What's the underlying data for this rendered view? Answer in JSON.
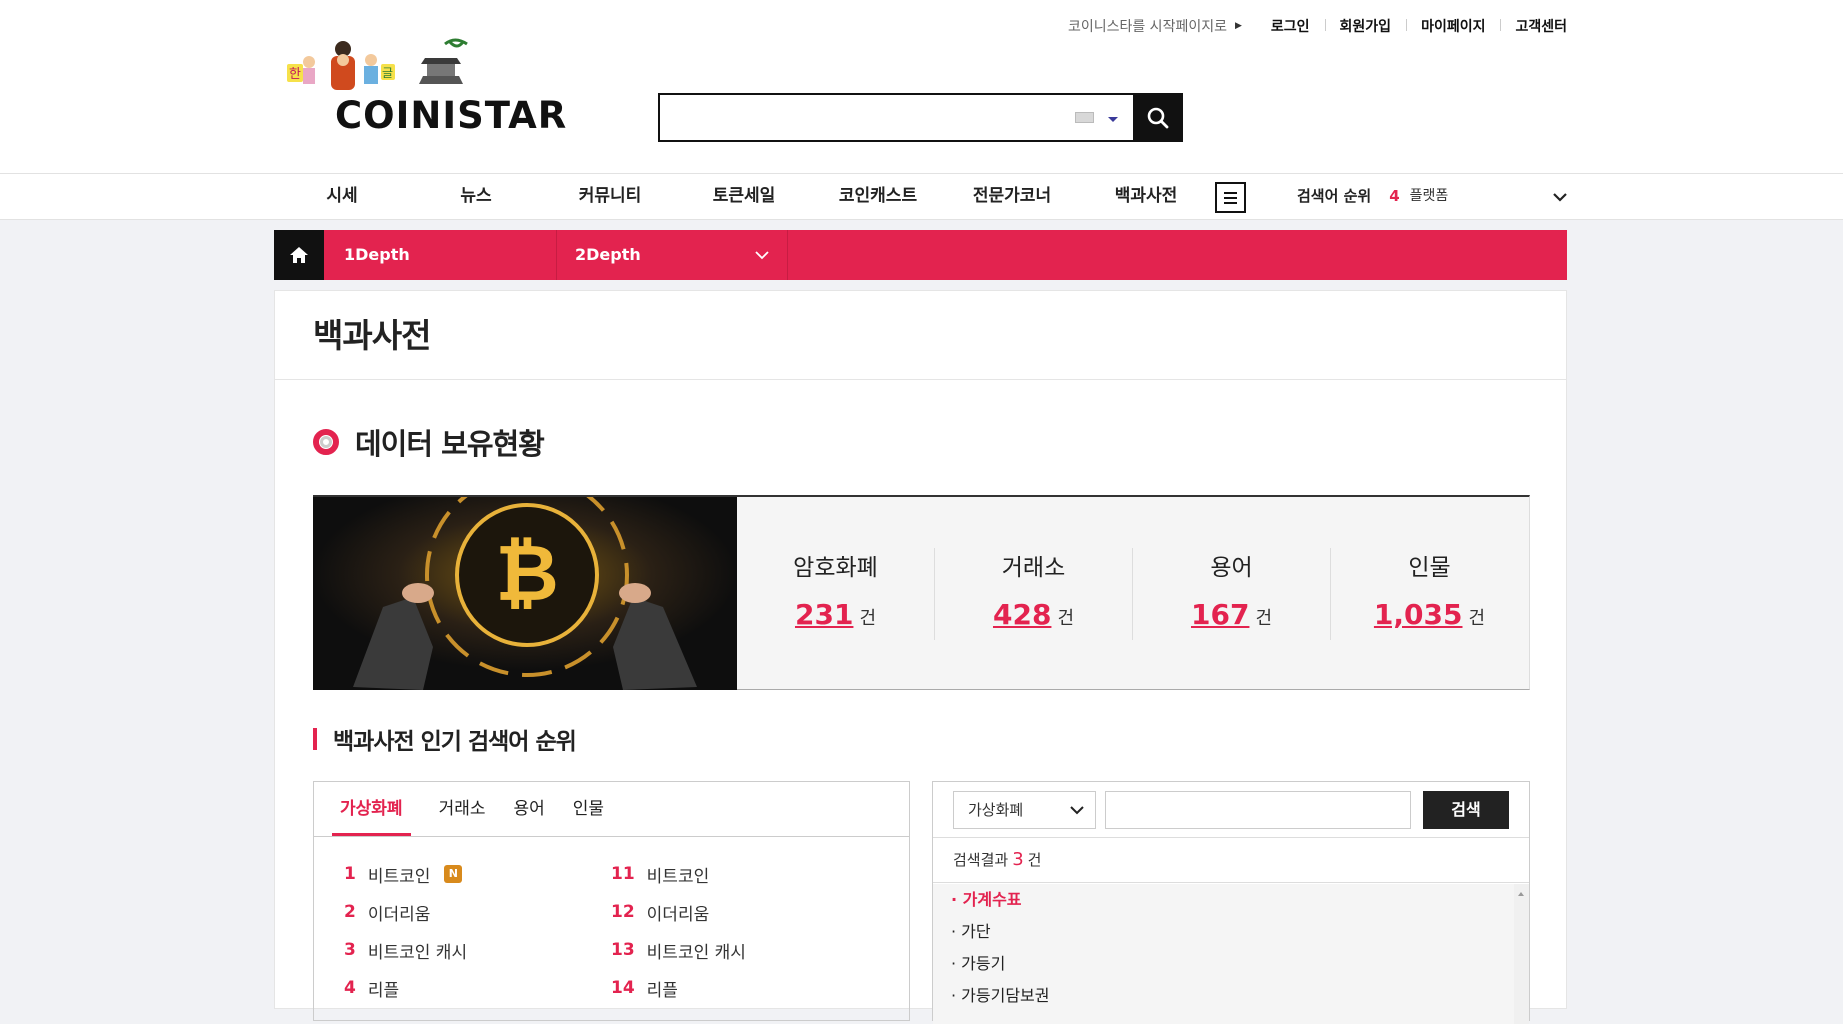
{
  "header": {
    "start_page_label": "코이니스타를 시작페이지로",
    "util_links": [
      "로그인",
      "회원가입",
      "마이페이지",
      "고객센터"
    ],
    "logo_text": "COINISTAR",
    "logo_badges": [
      "한",
      "글"
    ],
    "search_placeholder": ""
  },
  "gnb": {
    "menu": [
      "시세",
      "뉴스",
      "커뮤니티",
      "토큰세일",
      "코인캐스트",
      "전문가코너",
      "백과사전"
    ],
    "rank_label": "검색어 순위",
    "rank_num": "4",
    "rank_keyword": "플랫폼"
  },
  "location": {
    "depth1": "1Depth",
    "depth2": "2Depth"
  },
  "page": {
    "title": "백과사전",
    "section_title": "데이터 보유현황",
    "stats": [
      {
        "name": "암호화폐",
        "value": "231",
        "unit": "건"
      },
      {
        "name": "거래소",
        "value": "428",
        "unit": "건"
      },
      {
        "name": "용어",
        "value": "167",
        "unit": "건"
      },
      {
        "name": "인물",
        "value": "1,035",
        "unit": "건"
      }
    ],
    "rank_title": "백과사전 인기 검색어 순위",
    "tabs": [
      "가상화폐",
      "거래소",
      "용어",
      "인물"
    ],
    "rank_items": [
      {
        "n": "1",
        "label": "비트코인",
        "new": "N"
      },
      {
        "n": "11",
        "label": "비트코인"
      },
      {
        "n": "2",
        "label": "이더리움"
      },
      {
        "n": "12",
        "label": "이더리움"
      },
      {
        "n": "3",
        "label": "비트코인 캐시"
      },
      {
        "n": "13",
        "label": "비트코인 캐시"
      },
      {
        "n": "4",
        "label": "리플"
      },
      {
        "n": "14",
        "label": "리플"
      }
    ],
    "search": {
      "select_value": "가상화폐",
      "button": "검색",
      "result_prefix": "검색결과",
      "result_count": "3",
      "result_suffix": "건",
      "results": [
        "· 가계수표",
        "· 가단",
        "· 가등기",
        "· 가등기담보권"
      ]
    }
  },
  "colors": {
    "accent": "#e3234f",
    "dark": "#111111"
  }
}
